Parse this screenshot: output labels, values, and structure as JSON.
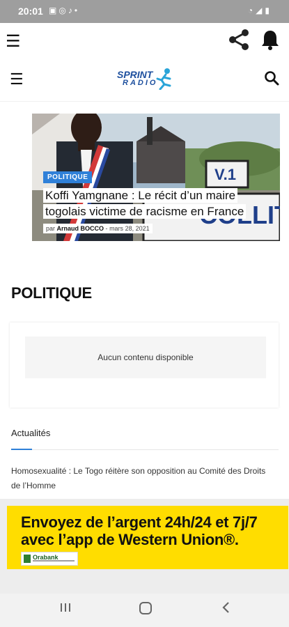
{
  "status_bar": {
    "time": "20:01",
    "left_icons": [
      "gallery-icon",
      "whatsapp-icon",
      "tiktok-icon",
      "dot-icon"
    ],
    "right_icons": [
      "wifi-icon",
      "signal-icon",
      "battery-icon"
    ]
  },
  "app_bar": {
    "menu_icon": "menu-icon",
    "share_icon": "share-icon",
    "notification_icon": "bell-icon"
  },
  "site_header": {
    "logo_line1": "SPRINT",
    "logo_line2": "RADIO",
    "search_icon": "search-icon"
  },
  "featured": {
    "category": "POLITIQUE",
    "title": "Koffi Yamgnane : Le récit d’un maire togolais victime de racisme en France",
    "author_prefix": "par",
    "author": "Arnaud BOCCO",
    "separator": "-",
    "date": "mars 28, 2021",
    "sign_text_1": "V.1",
    "sign_text_2": "COLLIT"
  },
  "section": {
    "title": "POLITIQUE",
    "empty_message": "Aucun contenu disponible"
  },
  "news": {
    "tab_label": "Actualités",
    "items": [
      "Homosexualité : Le Togo réitère son opposition au Comité des Droits de l’Homme"
    ]
  },
  "ad": {
    "headline": "Envoyez de l’argent 24h/24 et 7j/7 avec l’app de Western Union®.",
    "sponsor": "Orabank",
    "accent_color": "#ffdd00"
  },
  "nav_bar": {
    "recents_icon": "recents-icon",
    "home_icon": "home-icon",
    "back_icon": "back-icon"
  },
  "colors": {
    "accent": "#2f80d8",
    "brand_blue": "#1d4f9e"
  }
}
